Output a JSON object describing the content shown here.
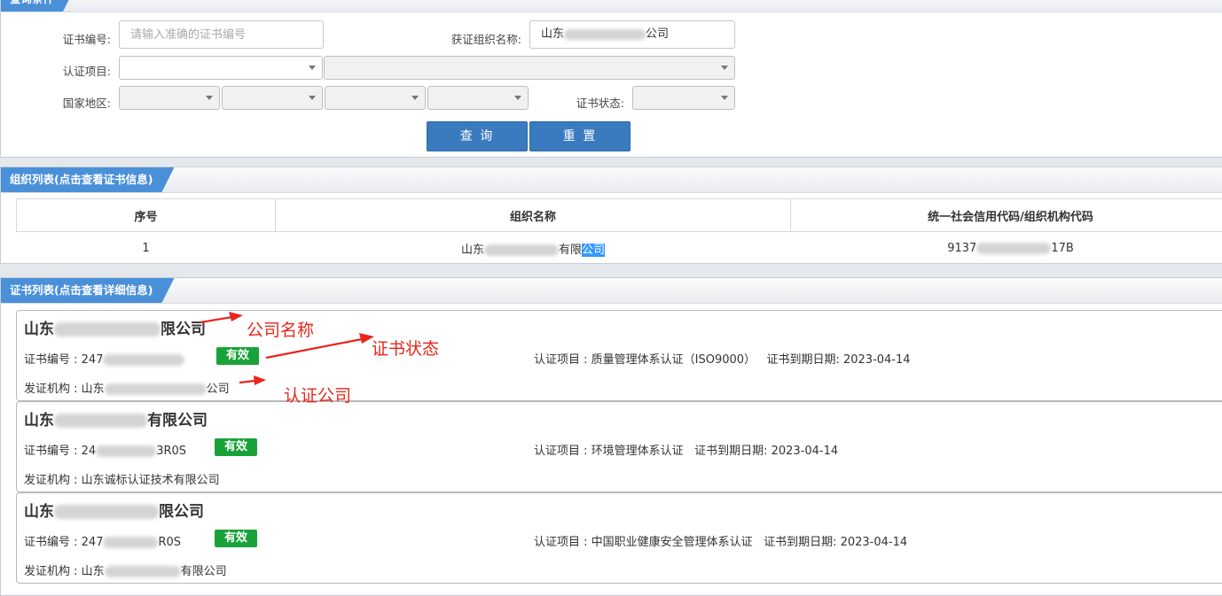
{
  "query": {
    "title": "查询条件",
    "cert_no_label": "证书编号:",
    "cert_no_placeholder": "请输入准确的证书编号",
    "org_label": "获证组织名称:",
    "org_value_prefix": "山东",
    "org_value_suffix": "公司",
    "project_label": "认证项目:",
    "region_label": "国家地区:",
    "status_label": "证书状态:",
    "search_btn": "查 询",
    "reset_btn": "重 置"
  },
  "org_list": {
    "title": "组织列表(点击查看证书信息)",
    "headers": [
      "序号",
      "组织名称",
      "统一社会信用代码/组织机构代码"
    ],
    "rows": [
      {
        "index": "1",
        "name_prefix": "山东",
        "name_mid": "有限",
        "name_hl": "公司",
        "code_prefix": "9137",
        "code_suffix": "17B"
      }
    ]
  },
  "cert_list": {
    "title": "证书列表(点击查看详细信息)",
    "cert_no_label": "证书编号 : ",
    "issuer_label": "发证机构 : ",
    "project_label": "认证项目 : ",
    "expiry_label": "证书到期日期: ",
    "items": [
      {
        "title_prefix": "山东",
        "title_suffix": "限公司",
        "no_prefix": "247",
        "no_suffix": "",
        "status": "有效",
        "project": "质量管理体系认证（ISO9000）",
        "expiry": "2023-04-14",
        "issuer_prefix": "山东",
        "issuer_suffix": "公司"
      },
      {
        "title_prefix": "山东",
        "title_suffix": "有限公司",
        "no_prefix": "24",
        "no_suffix": "3R0S",
        "status": "有效",
        "project": "环境管理体系认证",
        "expiry": "2023-04-14",
        "issuer_full": "山东诚标认证技术有限公司"
      },
      {
        "title_prefix": "山东",
        "title_suffix": "限公司",
        "no_prefix": "247",
        "no_suffix": "R0S",
        "status": "有效",
        "project": "中国职业健康安全管理体系认证",
        "expiry": "2023-04-14",
        "issuer_prefix": "山东",
        "issuer_suffix": "有限公司"
      }
    ]
  },
  "annotations": {
    "company_name": "公司名称",
    "cert_status": "证书状态",
    "cert_company": "认证公司",
    "color": "#e8271c"
  },
  "colors": {
    "accent": "#4a90d9",
    "button": "#3a7bbf",
    "valid_badge": "#1aa23a"
  }
}
